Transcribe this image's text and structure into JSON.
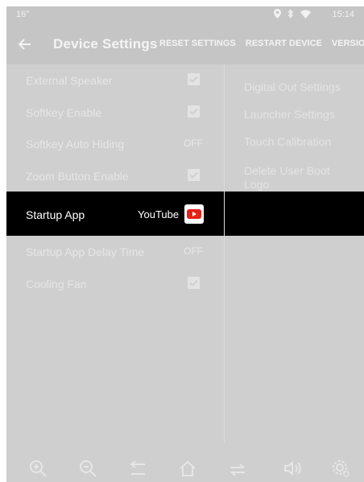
{
  "status_bar": {
    "temperature": "16°",
    "icons": [
      "location-icon",
      "bluetooth-icon",
      "wifi-icon"
    ],
    "time": "15:14"
  },
  "app_bar": {
    "back_icon": "back-arrow-icon",
    "title": "Device Settings",
    "actions": [
      "RESET SETTINGS",
      "RESTART DEVICE",
      "VERSION"
    ]
  },
  "left_settings": [
    {
      "label": "External Speaker",
      "control": "checkbox",
      "checked": true
    },
    {
      "label": "Softkey Enable",
      "control": "checkbox",
      "checked": true
    },
    {
      "label": "Softkey Auto Hiding",
      "control": "text",
      "value": "OFF"
    },
    {
      "label": "Zoom Button Enable",
      "control": "checkbox",
      "checked": true
    },
    {
      "label": "Startup App",
      "control": "app",
      "value": "YouTube",
      "icon": "youtube-icon"
    },
    {
      "label": "Startup App Delay Time",
      "control": "text",
      "value": "OFF"
    },
    {
      "label": "Cooling Fan",
      "control": "checkbox",
      "checked": true
    }
  ],
  "right_settings": [
    "Digital Out Settings",
    "Launcher Settings",
    "Touch Calibration",
    "Delete User Boot Logo"
  ],
  "nav_bar": [
    "zoom-in-icon",
    "zoom-out-icon",
    "back-icon",
    "home-icon",
    "recent-apps-icon",
    "volume-icon",
    "settings-icon"
  ],
  "colors": {
    "background_dim": "#cfcfcf",
    "bar": "#c5c5c5",
    "highlight": "#000000",
    "youtube_red": "#e62117"
  }
}
